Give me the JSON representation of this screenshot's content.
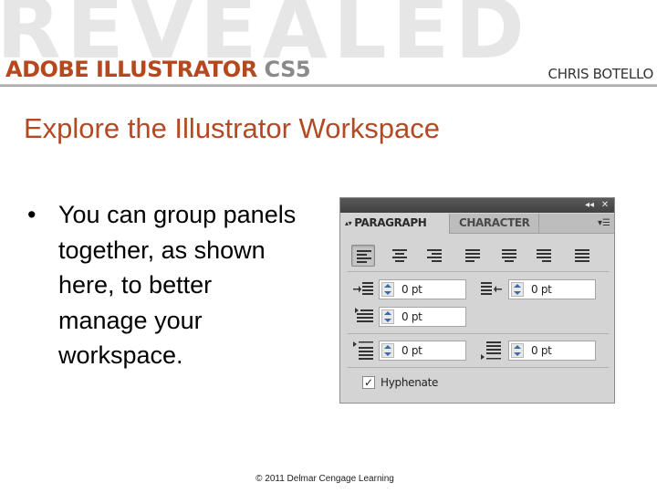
{
  "header": {
    "watermark": "REVEALED",
    "product_part1": "ADOBE ILLUSTRATOR",
    "product_part2": " CS5",
    "author": "CHRIS BOTELLO"
  },
  "slide": {
    "title": "Explore the Illustrator Workspace",
    "bullet": "You can group panels together, as shown here, to better manage your workspace.",
    "bullet_marker": "•"
  },
  "panel": {
    "titlebar_buttons": [
      "collapse-icon",
      "close-icon"
    ],
    "tabs": [
      {
        "label": "PARAGRAPH",
        "active": true
      },
      {
        "label": "CHARACTER",
        "active": false
      }
    ],
    "menu_icon": "panel-menu-icon",
    "alignment_buttons": [
      "align-left",
      "align-center",
      "align-right",
      "justify-last-left",
      "justify-last-center",
      "justify-last-right",
      "justify-all"
    ],
    "fields": {
      "left_indent": "0 pt",
      "right_indent": "0 pt",
      "first_line_indent": "0 pt",
      "space_before": "0 pt",
      "space_after": "0 pt"
    },
    "hyphenate": {
      "label": "Hyphenate",
      "checked": true
    }
  },
  "footer": {
    "copyright": "© 2011 Delmar Cengage Learning"
  }
}
